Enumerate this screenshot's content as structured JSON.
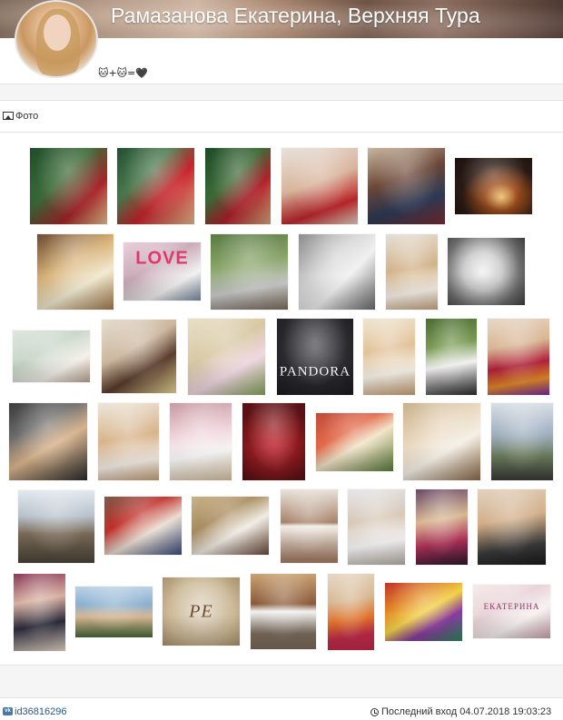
{
  "profile": {
    "title": "Рамазанова Екатерина, Верхняя Тура",
    "status_emoji": "🐱+🐱=🖤"
  },
  "photos_section": {
    "title": "Фото",
    "labels": {
      "love": "LOVE",
      "pandora": "PANDORA",
      "monogram": "РЕ",
      "card": "ЕКАТЕРИНА"
    }
  },
  "footer": {
    "user_id": "id36816296",
    "last_seen": "Последний вход 04.07.2018 19:03:23"
  },
  "colors": {
    "link": "#2a5885",
    "vk_brand": "#4a76a8"
  }
}
